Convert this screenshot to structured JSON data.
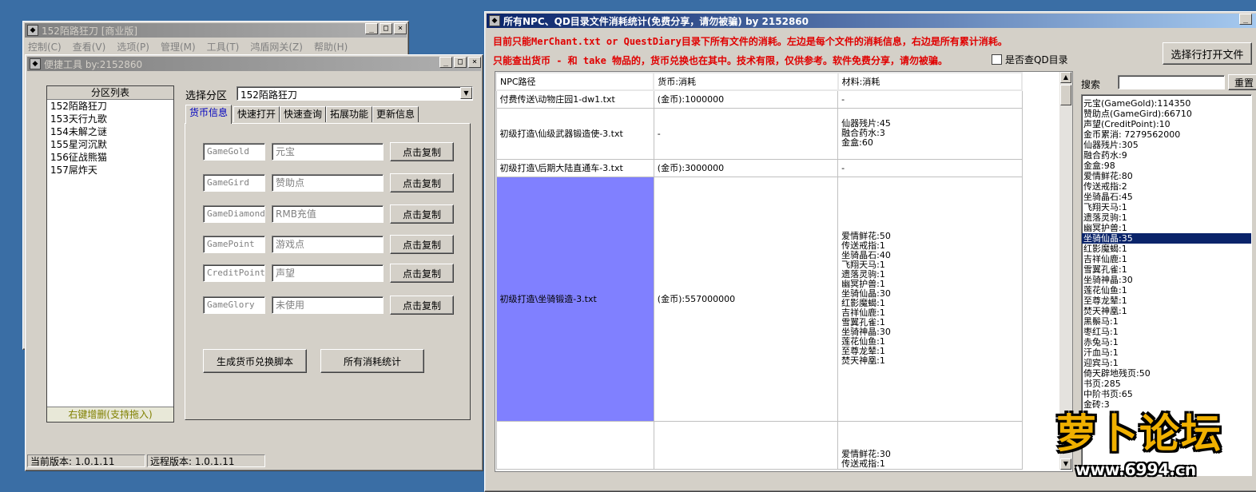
{
  "main_window": {
    "title": "152陌路狂刀 [商业版]",
    "menu": [
      "控制(C)",
      "查看(V)",
      "选项(P)",
      "管理(M)",
      "工具(T)",
      "鸿盾网关(Z)",
      "帮助(H)"
    ]
  },
  "tool_window": {
    "title": "便捷工具   by:2152860",
    "zone_list_header": "分区列表",
    "zones": [
      "152陌路狂刀",
      "153天行九歌",
      "154未解之谜",
      "155星河沉默",
      "156征战熊猫",
      "157屌炸天"
    ],
    "zone_list_footer": "右键增删(支持拖入)",
    "select_label": "选择分区",
    "select_value": "152陌路狂刀",
    "tabs": [
      "货币信息",
      "快速打开",
      "快速查询",
      "拓展功能",
      "更新信息"
    ],
    "currency_rows": [
      {
        "code": "GameGold",
        "name": "元宝",
        "button": "点击复制"
      },
      {
        "code": "GameGird",
        "name": "赞助点",
        "button": "点击复制"
      },
      {
        "code": "GameDiamond",
        "name": "RMB充值",
        "button": "点击复制"
      },
      {
        "code": "GamePoint",
        "name": "游戏点",
        "button": "点击复制"
      },
      {
        "code": "CreditPoint",
        "name": "声望",
        "button": "点击复制"
      },
      {
        "code": "GameGlory",
        "name": "未使用",
        "button": "点击复制"
      }
    ],
    "gen_script_button": "生成货币兑换脚本",
    "all_stats_button": "所有消耗统计",
    "status_current": "当前版本: 1.0.1.11",
    "status_remote": "远程版本: 1.0.1.11"
  },
  "stats_window": {
    "title": "所有NPC、QD目录文件消耗统计(免费分享，请勿被骗)    by 2152860",
    "notice1": "目前只能MerChant.txt or QuestDiary目录下所有文件的消耗。左边是每个文件的消耗信息，右边是所有累计消耗。",
    "notice2": "只能查出货币 - 和 take 物品的，货币兑换也在其中。技术有限，仅供参考。软件免费分享，请勿被骗。",
    "qd_checkbox_label": "是否查QD目录",
    "open_button": "选择行打开文件",
    "search_label": "搜索",
    "search_value": "",
    "reset_button": "重置",
    "columns": [
      "NPC路径",
      "货币:消耗",
      "材料:消耗"
    ],
    "rows": [
      {
        "path": "付费传送\\动物庄园1-dw1.txt",
        "currency": "(金币):1000000",
        "materials": [
          "-"
        ]
      },
      {
        "path": "初级打造\\仙级武器锻造使-3.txt",
        "currency": "-",
        "materials": [
          "仙器残片:45",
          "融合药水:3",
          "金盒:60"
        ]
      },
      {
        "path": "初级打造\\后期大陆直通车-3.txt",
        "currency": "(金币):3000000",
        "materials": [
          "-"
        ]
      },
      {
        "path": "初级打造\\坐骑锻造-3.txt",
        "currency": "(金币):557000000",
        "materials": [
          "爱情鲜花:50",
          "传送戒指:1",
          "坐骑晶石:40",
          "飞翔天马:1",
          "遗落灵驹:1",
          "幽冥护兽:1",
          "坐骑仙晶:30",
          "红影魔蝎:1",
          "吉祥仙鹿:1",
          "雪翼孔雀:1",
          "坐骑神晶:30",
          "莲花仙鱼:1",
          "至尊龙辇:1",
          "焚天神凰:1"
        ]
      },
      {
        "path": "",
        "currency": "",
        "materials": [
          "爱情鲜花:30",
          "传送戒指:1"
        ]
      }
    ],
    "totals": [
      "元宝(GameGold):114350",
      "赞助点(GameGird):66710",
      "声望(CreditPoint):10",
      "金币累消: 7279562000",
      "仙器残片:305",
      "融合药水:9",
      "金盒:98",
      "爱情鲜花:80",
      "传送戒指:2",
      "坐骑晶石:45",
      "飞翔天马:1",
      "遗落灵驹:1",
      "幽冥护兽:1",
      "坐骑仙晶:35",
      "红影魔蝎:1",
      "吉祥仙鹿:1",
      "雪翼孔雀:1",
      "坐骑神晶:30",
      "莲花仙鱼:1",
      "至尊龙辇:1",
      "焚天神凰:1",
      "黑鬃马:1",
      "枣红马:1",
      "赤兔马:1",
      "汗血马:1",
      "迎宾马:1",
      "倚天辟地残页:50",
      "书页:285",
      "中阶书页:65",
      "金砖:3"
    ],
    "totals_selected": "坐骑仙晶:35"
  },
  "watermark": {
    "brand": "萝卜论坛",
    "url": "www.6994.cn"
  }
}
